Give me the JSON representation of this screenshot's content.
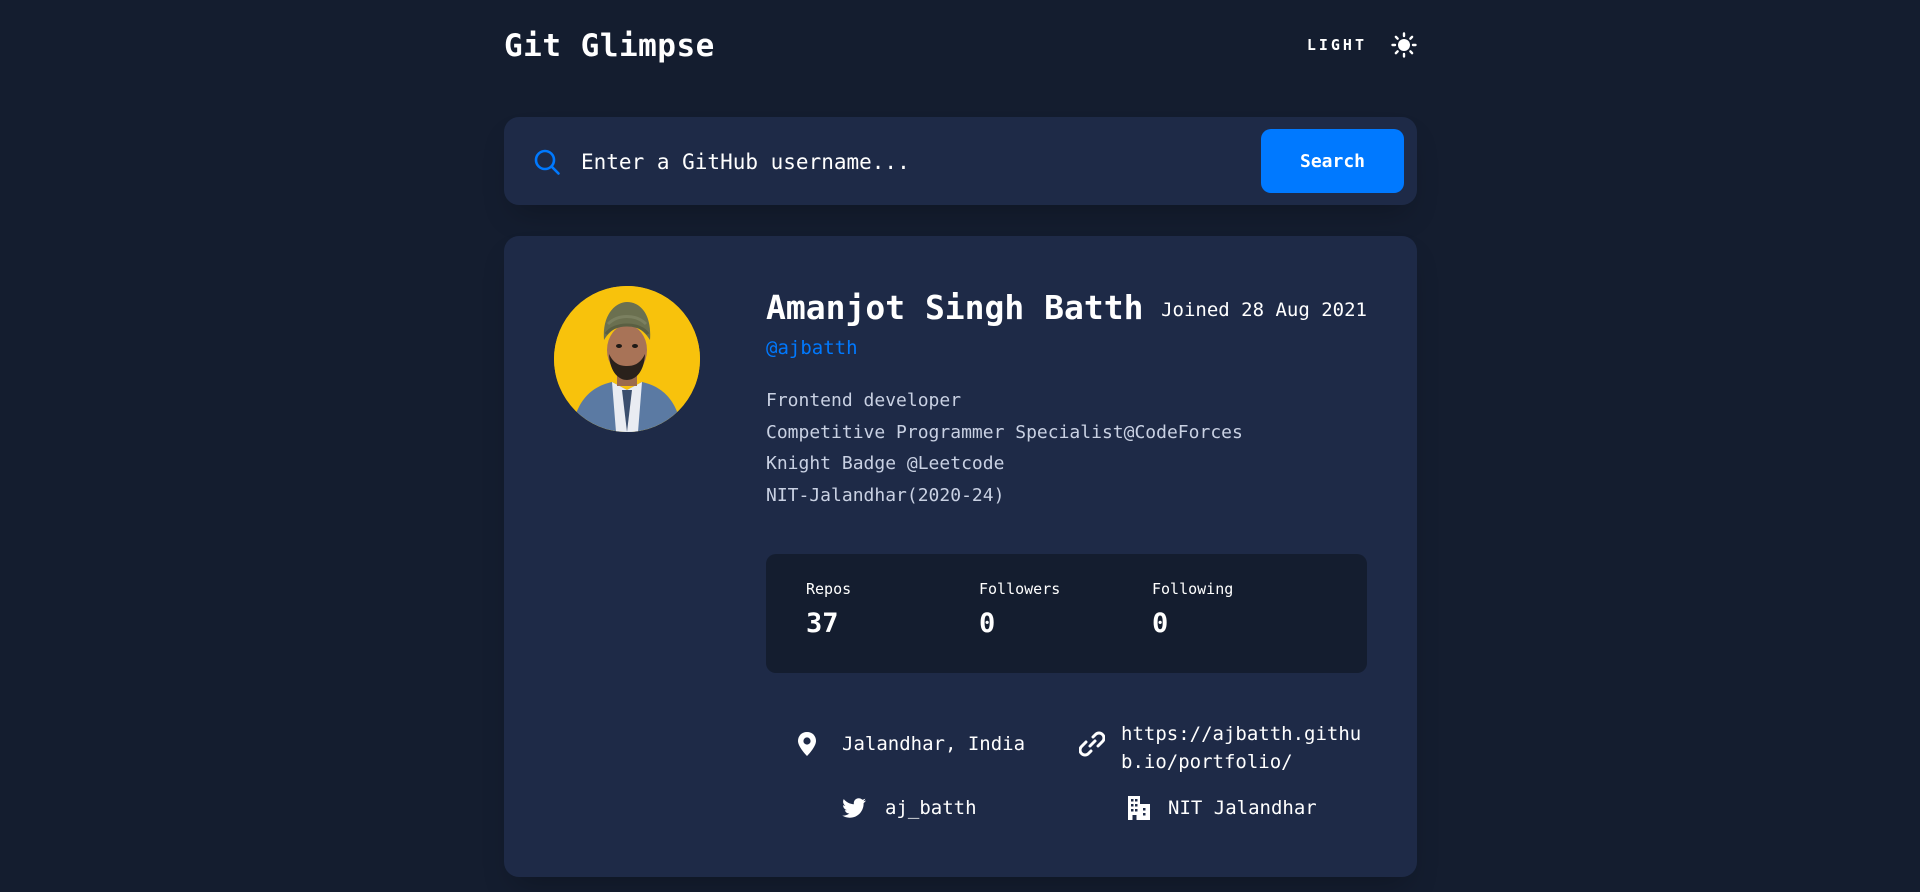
{
  "app": {
    "title": "Git Glimpse",
    "theme_toggle_label": "LIGHT"
  },
  "search": {
    "placeholder": "Enter a GitHub username...",
    "button_label": "Search"
  },
  "profile": {
    "name": "Amanjot Singh Batth",
    "joined": "Joined 28 Aug 2021",
    "handle": "@ajbatth",
    "bio": [
      "Frontend developer",
      "Competitive Programmer Specialist@CodeForces",
      "Knight Badge @Leetcode",
      "NIT-Jalandhar(2020-24)"
    ],
    "stats": [
      {
        "label": "Repos",
        "value": "37"
      },
      {
        "label": "Followers",
        "value": "0"
      },
      {
        "label": "Following",
        "value": "0"
      }
    ],
    "location": "Jalandhar, India",
    "website_line1": "https://ajbatth.githu",
    "website_line2": "b.io/portfolio/",
    "twitter": "aj_batth",
    "company": "NIT Jalandhar"
  },
  "icons": {
    "theme": "sun-icon",
    "search": "search-icon",
    "location": "location-pin-icon",
    "website": "link-icon",
    "twitter": "twitter-icon",
    "company": "building-icon"
  },
  "colors": {
    "background": "#141d2f",
    "card": "#1e2a47",
    "accent": "#0079ff",
    "text": "#ffffff",
    "avatar_bg": "#f8c20c"
  }
}
